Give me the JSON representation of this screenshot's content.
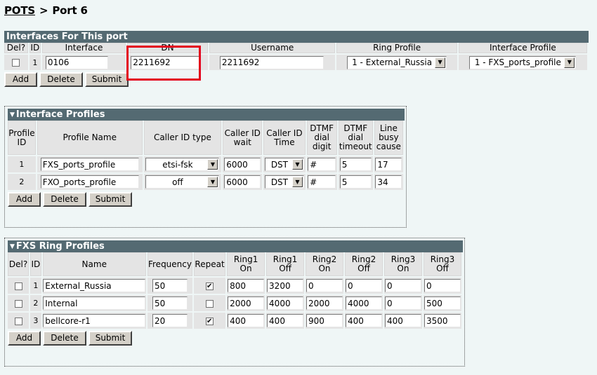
{
  "breadcrumb": {
    "root": "POTS",
    "separator": ">",
    "current": "Port 6"
  },
  "interfaces": {
    "title": "Interfaces For This port",
    "headers": [
      "Del?",
      "ID",
      "Interface",
      "DN",
      "Username",
      "Ring Profile",
      "Interface Profile"
    ],
    "row": {
      "id": "1",
      "interface": "0106",
      "dn": "2211692",
      "username": "2211692",
      "ring_profile": "1 - External_Russia",
      "interface_profile": "1 - FXS_ports_profile"
    },
    "buttons": {
      "add": "Add",
      "delete": "Delete",
      "submit": "Submit"
    }
  },
  "interface_profiles": {
    "title": "Interface Profiles",
    "headers": {
      "profile_id": [
        "Profile",
        "ID"
      ],
      "profile_name": "Profile Name",
      "caller_id_type": "Caller ID type",
      "caller_id_wait": [
        "Caller ID",
        "wait"
      ],
      "caller_id_time": [
        "Caller ID",
        "Time"
      ],
      "dtmf_dial_digit": [
        "DTMF",
        "dial",
        "digit"
      ],
      "dtmf_dial_timeout": [
        "DTMF",
        "dial",
        "timeout"
      ],
      "line_busy_cause": [
        "Line",
        "busy",
        "cause"
      ]
    },
    "rows": [
      {
        "id": "1",
        "name": "FXS_ports_profile",
        "caller_id_type": "etsi-fsk",
        "wait": "6000",
        "time": "DST",
        "digit": "#",
        "timeout": "5",
        "cause": "17"
      },
      {
        "id": "2",
        "name": "FXO_ports_profile",
        "caller_id_type": "off",
        "wait": "6000",
        "time": "DST",
        "digit": "#",
        "timeout": "5",
        "cause": "34"
      }
    ],
    "buttons": {
      "add": "Add",
      "delete": "Delete",
      "submit": "Submit"
    }
  },
  "ring_profiles": {
    "title": "FXS Ring Profiles",
    "headers": {
      "del": "Del?",
      "id": "ID",
      "name": "Name",
      "frequency": "Frequency",
      "repeat": "Repeat",
      "ring1_on": [
        "Ring1",
        "On"
      ],
      "ring1_off": [
        "Ring1",
        "Off"
      ],
      "ring2_on": [
        "Ring2",
        "On"
      ],
      "ring2_off": [
        "Ring2",
        "Off"
      ],
      "ring3_on": [
        "Ring3",
        "On"
      ],
      "ring3_off": [
        "Ring3",
        "Off"
      ]
    },
    "rows": [
      {
        "id": "1",
        "name": "External_Russia",
        "frequency": "50",
        "repeat": true,
        "r1on": "800",
        "r1off": "3200",
        "r2on": "0",
        "r2off": "0",
        "r3on": "0",
        "r3off": "0"
      },
      {
        "id": "2",
        "name": "Internal",
        "frequency": "50",
        "repeat": false,
        "r1on": "2000",
        "r1off": "4000",
        "r2on": "2000",
        "r2off": "4000",
        "r3on": "0",
        "r3off": "500"
      },
      {
        "id": "3",
        "name": "bellcore-r1",
        "frequency": "20",
        "repeat": true,
        "r1on": "400",
        "r1off": "400",
        "r2on": "900",
        "r2off": "400",
        "r3on": "400",
        "r3off": "3500"
      }
    ],
    "buttons": {
      "add": "Add",
      "delete": "Delete",
      "submit": "Submit"
    }
  },
  "highlight_color": "#e3001b"
}
